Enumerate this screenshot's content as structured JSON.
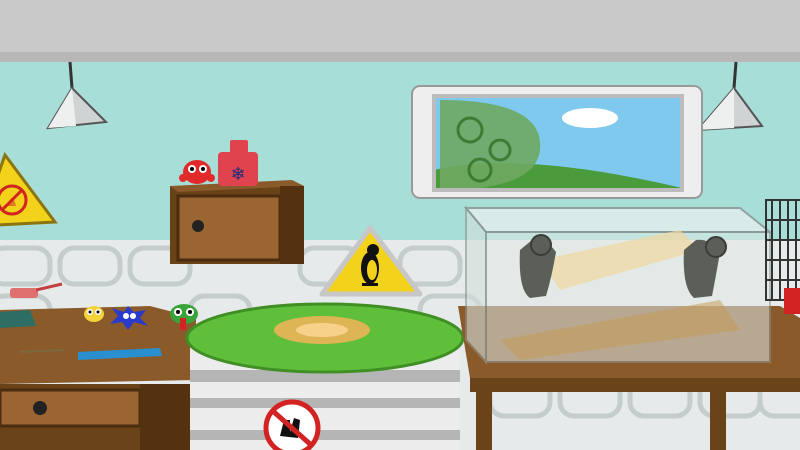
{
  "scene": {
    "colors": {
      "ceiling": "#c8c8c8",
      "wall": "#a8ded8",
      "wall_dark": "#8fcfc8",
      "tile": "#e9ecec",
      "tile_outline": "#bfc7c7",
      "wood": "#8a5a2b",
      "wood_dark": "#5a3615",
      "shelf": "#7a4b1e",
      "goo": "#5fbf3a",
      "goo_glow": "#f3b35a",
      "tank_glass": "#dfe9e6",
      "sky": "#7fc9ee",
      "hill": "#4a9b3c",
      "warning_yellow": "#f2d21b",
      "prohibit_red": "#d22222"
    },
    "objects": [
      {
        "id": "lamp-left",
        "icon": "hanging-lamp"
      },
      {
        "id": "lamp-right",
        "icon": "hanging-lamp"
      },
      {
        "id": "window",
        "icon": "window-view"
      },
      {
        "id": "wall-cabinet",
        "icon": "drawer-cabinet"
      },
      {
        "id": "red-creature",
        "icon": "red-blob-creature"
      },
      {
        "id": "red-bottle",
        "icon": "snowflake-bottle"
      },
      {
        "id": "penguin-sign",
        "icon": "penguin-warning-sign"
      },
      {
        "id": "fire-sign",
        "icon": "no-fire-sign"
      },
      {
        "id": "goo-barrel",
        "icon": "green-goo-barrel"
      },
      {
        "id": "no-touch-sign",
        "icon": "no-hand-sign"
      },
      {
        "id": "left-desk",
        "icon": "wooden-desk"
      },
      {
        "id": "yellow-creature",
        "icon": "yellow-creature"
      },
      {
        "id": "blue-creature",
        "icon": "blue-spiky-creature"
      },
      {
        "id": "green-creature",
        "icon": "green-creature"
      },
      {
        "id": "ruler",
        "icon": "blue-ruler"
      },
      {
        "id": "glass-tank",
        "icon": "glovebox-tank"
      },
      {
        "id": "gloves",
        "icon": "rubber-gloves"
      },
      {
        "id": "right-table",
        "icon": "wooden-table"
      },
      {
        "id": "wire-cage",
        "icon": "wire-cage"
      }
    ]
  }
}
